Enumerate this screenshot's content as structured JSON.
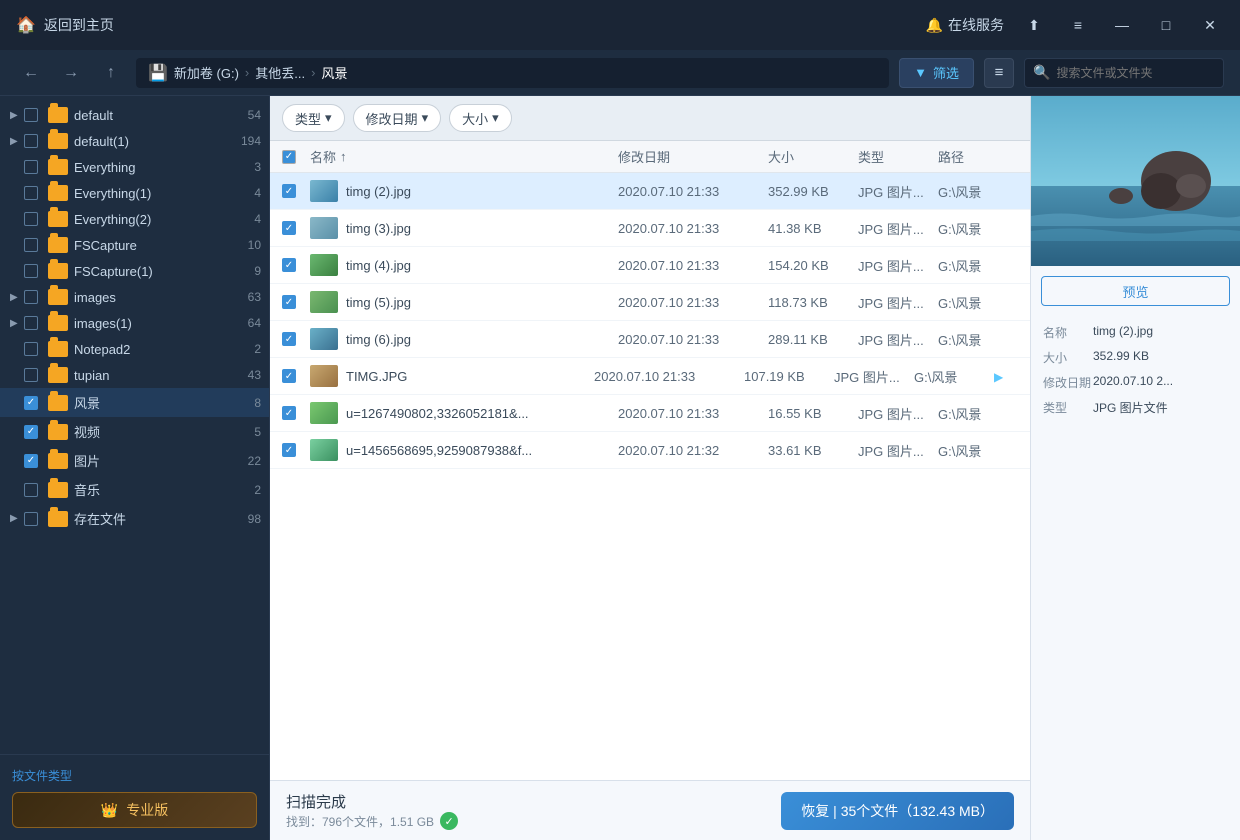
{
  "titlebar": {
    "home_label": "返回到主页",
    "online_service": "在线服务",
    "share_icon": "⬆",
    "menu_icon": "≡",
    "min_icon": "—",
    "max_icon": "□",
    "close_icon": "✕"
  },
  "toolbar": {
    "back_icon": "←",
    "forward_icon": "→",
    "up_icon": "↑",
    "drive_label": "新加卷 (G:)",
    "path_sep1": "›",
    "path_part1": "其他丢...",
    "path_sep2": "›",
    "path_part2": "风景",
    "filter_label": "筛选",
    "search_placeholder": "搜索文件或文件夹"
  },
  "filter_bar": {
    "type_label": "类型",
    "date_label": "修改日期",
    "size_label": "大小",
    "dropdown_icon": "▾"
  },
  "file_list": {
    "header": {
      "check": "",
      "name": "名称",
      "sort_icon": "↑",
      "date": "修改日期",
      "size": "大小",
      "type": "类型",
      "path": "路径"
    },
    "files": [
      {
        "id": 1,
        "checked": true,
        "selected": true,
        "name": "timg (2).jpg",
        "date": "2020.07.10 21:33",
        "size": "352.99 KB",
        "type": "JPG 图片...",
        "path": "G:\\风景"
      },
      {
        "id": 2,
        "checked": true,
        "selected": false,
        "name": "timg (3).jpg",
        "date": "2020.07.10 21:33",
        "size": "41.38 KB",
        "type": "JPG 图片...",
        "path": "G:\\风景"
      },
      {
        "id": 3,
        "checked": true,
        "selected": false,
        "name": "timg (4).jpg",
        "date": "2020.07.10 21:33",
        "size": "154.20 KB",
        "type": "JPG 图片...",
        "path": "G:\\风景"
      },
      {
        "id": 4,
        "checked": true,
        "selected": false,
        "name": "timg (5).jpg",
        "date": "2020.07.10 21:33",
        "size": "118.73 KB",
        "type": "JPG 图片...",
        "path": "G:\\风景"
      },
      {
        "id": 5,
        "checked": true,
        "selected": false,
        "name": "timg (6).jpg",
        "date": "2020.07.10 21:33",
        "size": "289.11 KB",
        "type": "JPG 图片...",
        "path": "G:\\风景"
      },
      {
        "id": 6,
        "checked": true,
        "selected": false,
        "name": "TIMG.JPG",
        "date": "2020.07.10 21:33",
        "size": "107.19 KB",
        "type": "JPG 图片...",
        "path": "G:\\风景"
      },
      {
        "id": 7,
        "checked": true,
        "selected": false,
        "name": "u=1267490802,3326052181&...",
        "date": "2020.07.10 21:33",
        "size": "16.55 KB",
        "type": "JPG 图片...",
        "path": "G:\\风景"
      },
      {
        "id": 8,
        "checked": true,
        "selected": false,
        "name": "u=1456568695,9259087938&f...",
        "date": "2020.07.10 21:32",
        "size": "33.61 KB",
        "type": "JPG 图片...",
        "path": "G:\\风景"
      }
    ]
  },
  "sidebar": {
    "items": [
      {
        "name": "default",
        "count": "54",
        "checked": false,
        "expanded": false
      },
      {
        "name": "default(1)",
        "count": "194",
        "checked": false,
        "expanded": false
      },
      {
        "name": "Everything",
        "count": "3",
        "checked": false,
        "expanded": false
      },
      {
        "name": "Everything(1)",
        "count": "4",
        "checked": false,
        "expanded": false
      },
      {
        "name": "Everything(2)",
        "count": "4",
        "checked": false,
        "expanded": false
      },
      {
        "name": "FSCapture",
        "count": "10",
        "checked": false,
        "expanded": false
      },
      {
        "name": "FSCapture(1)",
        "count": "9",
        "checked": false,
        "expanded": false
      },
      {
        "name": "images",
        "count": "63",
        "checked": false,
        "expanded": false
      },
      {
        "name": "images(1)",
        "count": "64",
        "checked": false,
        "expanded": false
      },
      {
        "name": "Notepad2",
        "count": "2",
        "checked": false,
        "expanded": false
      },
      {
        "name": "tupian",
        "count": "43",
        "checked": false,
        "expanded": false
      },
      {
        "name": "风景",
        "count": "8",
        "checked": true,
        "expanded": false,
        "active": true
      },
      {
        "name": "视频",
        "count": "5",
        "checked": true,
        "expanded": false
      },
      {
        "name": "图片",
        "count": "22",
        "checked": true,
        "expanded": false
      },
      {
        "name": "音乐",
        "count": "2",
        "checked": false,
        "expanded": false
      },
      {
        "name": "存在文件",
        "count": "98",
        "checked": false,
        "expanded": true
      }
    ],
    "file_type_label": "按文件类型",
    "pro_btn": "专业版",
    "crown_icon": "👑"
  },
  "right_panel": {
    "preview_btn": "预览",
    "file_info": {
      "name_label": "名称",
      "name_value": "timg (2).jpg",
      "size_label": "大小",
      "size_value": "352.99 KB",
      "date_label": "修改日期",
      "date_value": "2020.07.10 2...",
      "type_label": "类型",
      "type_value": "JPG 图片文件"
    }
  },
  "status_bar": {
    "title": "扫描完成",
    "sub": "找到：796个文件，1.51 GB",
    "restore_btn": "恢复 | 35个文件（132.43 MB）"
  }
}
